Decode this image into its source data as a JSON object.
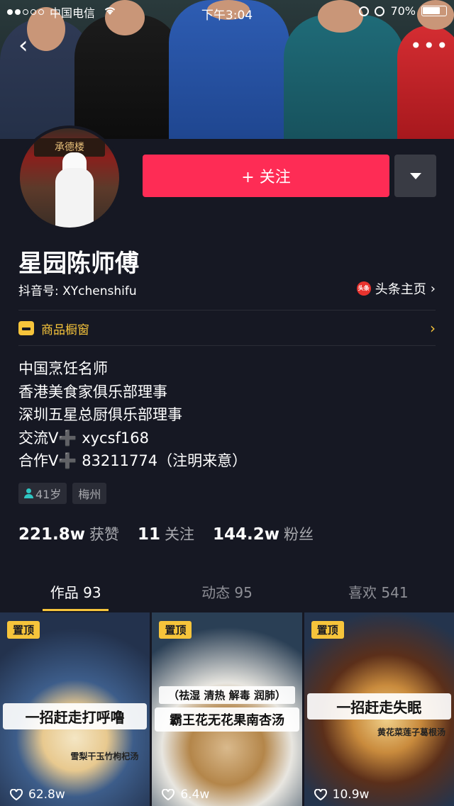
{
  "status_bar": {
    "carrier": "中国电信",
    "time": "下午3:04",
    "battery": "70%"
  },
  "profile": {
    "avatar_sign": "承德楼",
    "follow_label": "+ 关注",
    "name": "星园陈师傅",
    "douyin_id": "抖音号: XYchenshifu",
    "toutiao_logo": "头条",
    "toutiao_link": "头条主页",
    "shop_label": "商品橱窗",
    "bio": [
      "中国烹饪名师",
      "香港美食家俱乐部理事",
      "深圳五星总厨俱乐部理事",
      "交流V➕ xycsf168",
      "合作V➕ 83211774（注明来意）"
    ],
    "tags": {
      "age": "41岁",
      "city": "梅州"
    },
    "stats": [
      {
        "num": "221.8w",
        "label": "获赞"
      },
      {
        "num": "11",
        "label": "关注"
      },
      {
        "num": "144.2w",
        "label": "粉丝"
      }
    ]
  },
  "tabs": [
    {
      "label": "作品 93"
    },
    {
      "label": "动态 95"
    },
    {
      "label": "喜欢 541"
    }
  ],
  "videos": [
    {
      "pin": "置顶",
      "top": "",
      "caption": "一招赶走打呼噜",
      "sub": "雪梨干玉竹枸杞汤",
      "likes": "62.8w"
    },
    {
      "pin": "置顶",
      "top": "（祛湿 清热 解毒 润肺）",
      "caption": "霸王花无花果南杏汤",
      "sub": "",
      "likes": "6.4w"
    },
    {
      "pin": "置顶",
      "top": "",
      "caption": "一招赶走失眠",
      "sub": "黄花菜莲子葛根汤",
      "likes": "10.9w"
    }
  ],
  "colors": {
    "background": "#161823",
    "follow": "#fe2c55",
    "accent": "#f6c43b"
  }
}
